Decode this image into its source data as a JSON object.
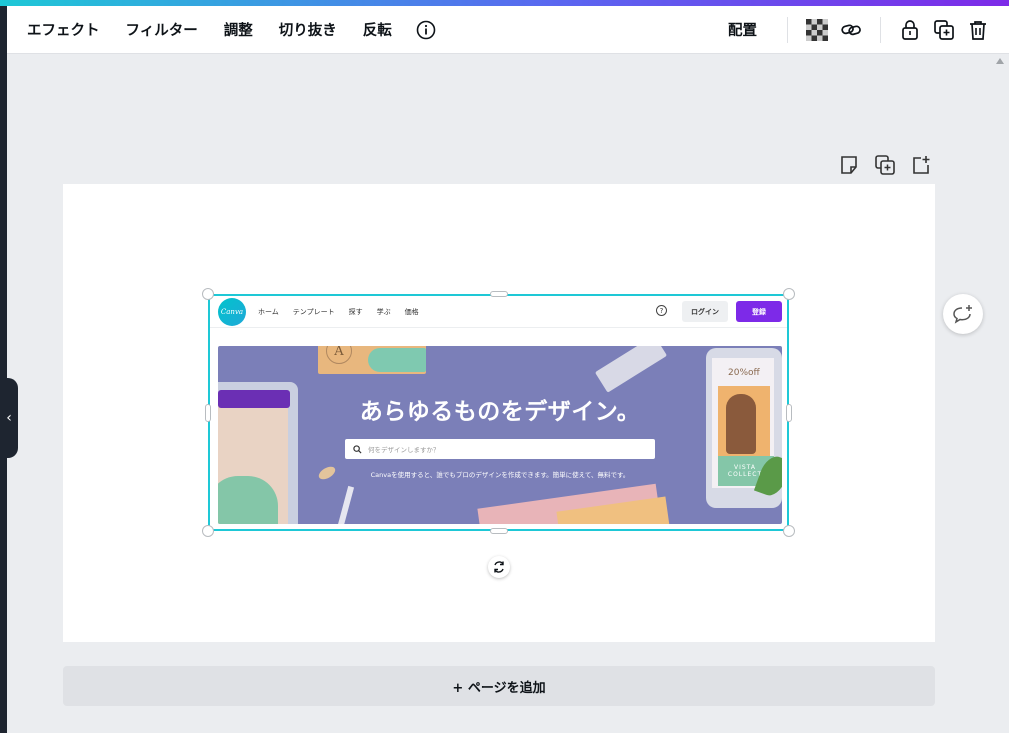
{
  "toolbar": {
    "left_items": [
      "エフェクト",
      "フィルター",
      "調整",
      "切り抜き",
      "反転"
    ],
    "info_icon": "info-icon",
    "position_label": "配置",
    "right_icons": [
      "transparency-icon",
      "link-icon",
      "unlock-icon",
      "duplicate-icon",
      "trash-icon"
    ]
  },
  "page_actions": [
    "note-icon",
    "duplicate-page-icon",
    "add-page-icon"
  ],
  "canvas": {
    "embedded_screenshot": {
      "logo": "Canva",
      "nav": [
        "ホーム",
        "テンプレート",
        "探す",
        "学ぶ",
        "価格"
      ],
      "help": "?",
      "login": "ログイン",
      "register": "登録",
      "hero_title": "あらゆるものをデザイン。",
      "search_placeholder": "何をデザインしますか？",
      "hero_subtitle": "Canvaを使用すると、誰でもプロのデザインを作成できます。簡単に使えて、無料です。",
      "promo_text": "20%off",
      "collection_text": "VISTA COLLECT"
    }
  },
  "add_page_label": "+ ページを追加",
  "colors": {
    "selection": "#1ec8d6",
    "brand_purple": "#7d2ae8",
    "hero_bg": "#7b7fb8"
  }
}
